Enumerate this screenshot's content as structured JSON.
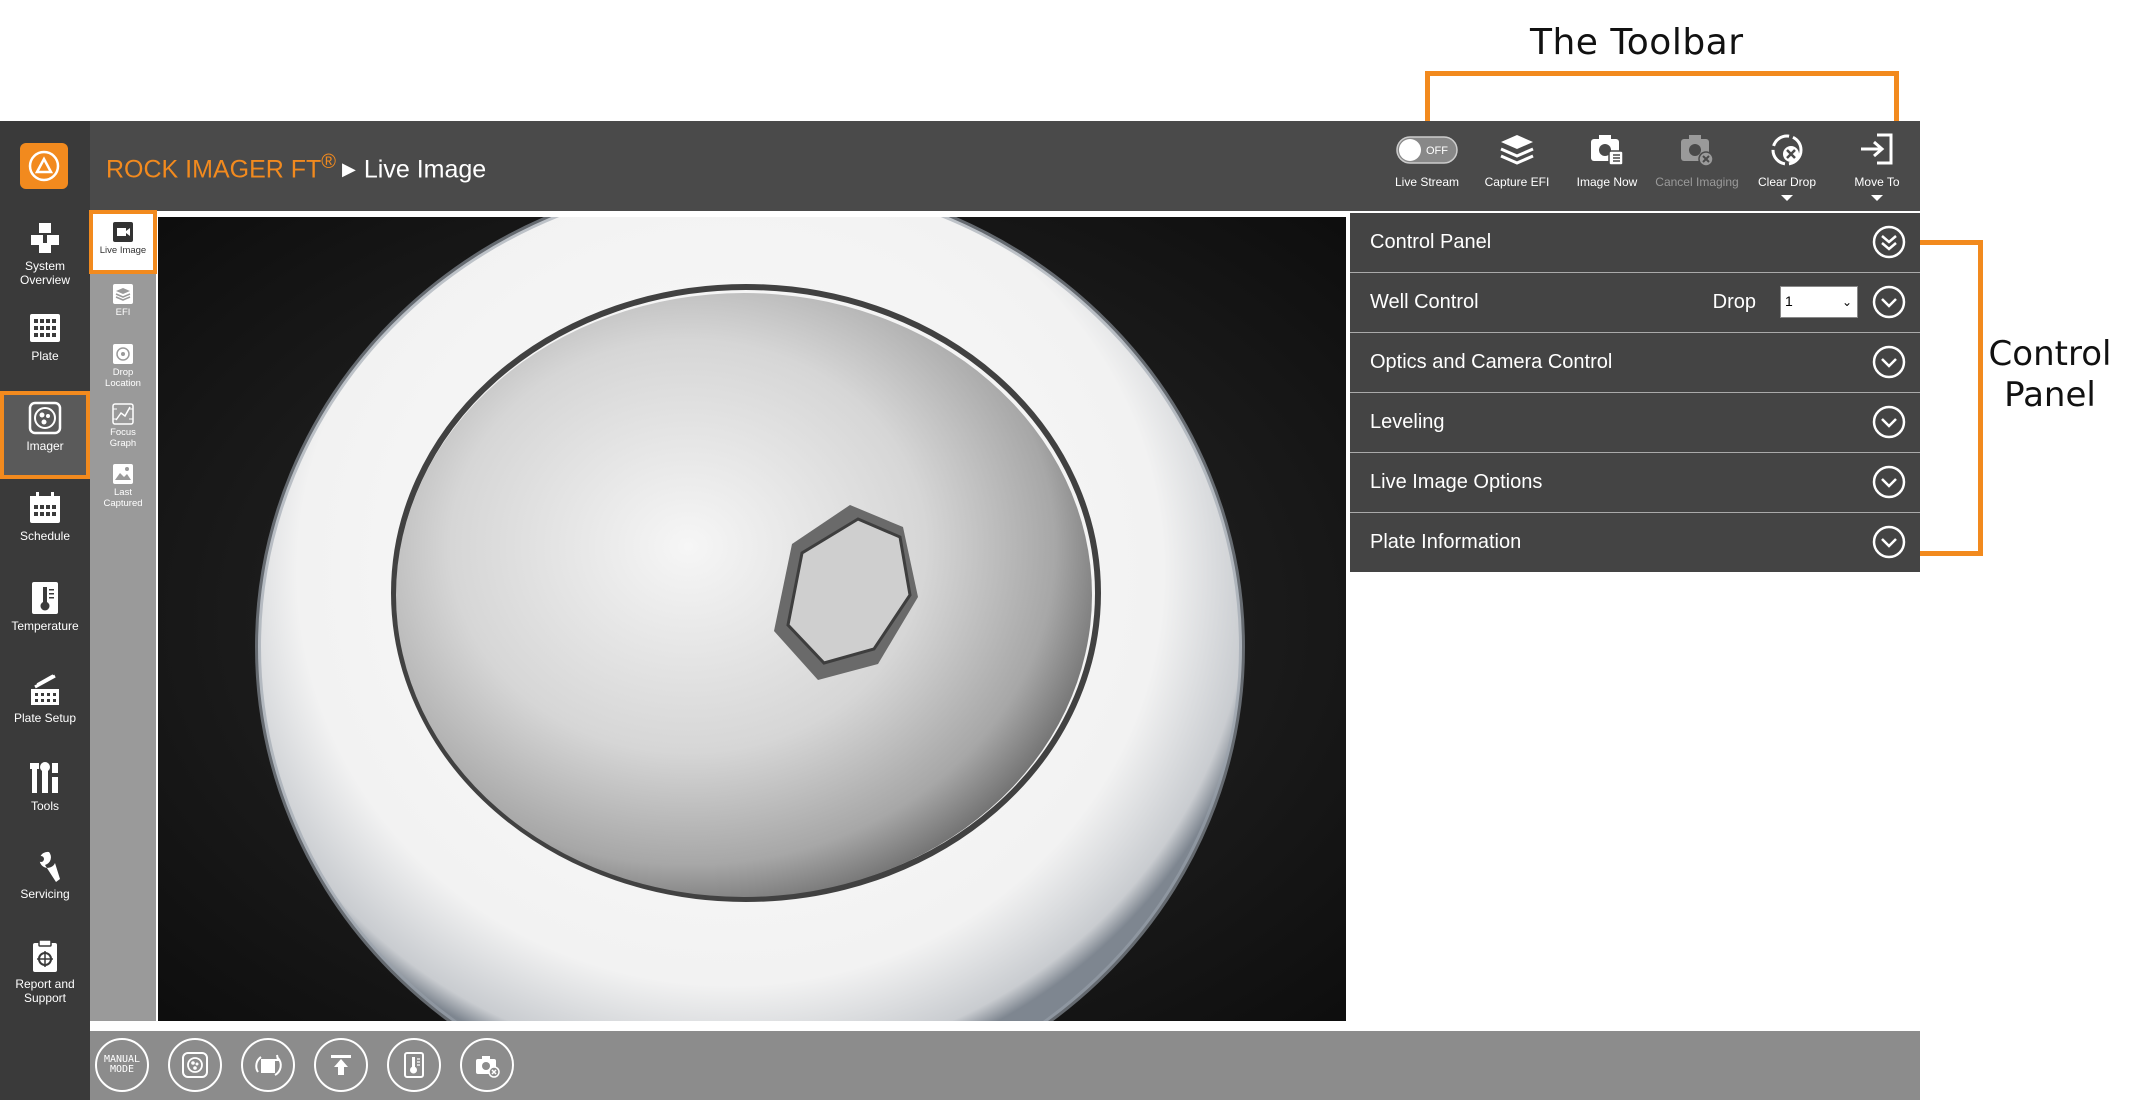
{
  "annotations": {
    "toolbar_title": "The Toolbar",
    "control_panel_title_line1": "Control",
    "control_panel_title_line2": "Panel",
    "accent_color": "#f28a1e"
  },
  "header": {
    "app_name": "ROCK IMAGER FT",
    "registered_mark": "®",
    "page_title": "Live Image"
  },
  "sidebar": {
    "items": [
      {
        "label_line1": "System",
        "label_line2": "Overview",
        "icon": "cubes-icon"
      },
      {
        "label_line1": "Plate",
        "label_line2": "",
        "icon": "plate-grid-icon"
      },
      {
        "label_line1": "Imager",
        "label_line2": "",
        "icon": "imager-icon",
        "active": true
      },
      {
        "label_line1": "Schedule",
        "label_line2": "",
        "icon": "calendar-icon"
      },
      {
        "label_line1": "Temperature",
        "label_line2": "",
        "icon": "thermometer-icon"
      },
      {
        "label_line1": "Plate Setup",
        "label_line2": "",
        "icon": "plate-setup-icon"
      },
      {
        "label_line1": "Tools",
        "label_line2": "",
        "icon": "tools-icon"
      },
      {
        "label_line1": "Servicing",
        "label_line2": "",
        "icon": "wrench-icon"
      },
      {
        "label_line1": "Report and",
        "label_line2": "Support",
        "icon": "clipboard-icon"
      }
    ]
  },
  "toolbar": {
    "live_stream": {
      "label": "Live Stream",
      "toggle_text": "OFF",
      "state": "off"
    },
    "capture_efi": {
      "label": "Capture EFI"
    },
    "image_now": {
      "label": "Image Now"
    },
    "cancel_imaging": {
      "label": "Cancel Imaging",
      "disabled": true
    },
    "clear_drop": {
      "label": "Clear Drop"
    },
    "move_to": {
      "label": "Move To"
    }
  },
  "subnav": {
    "items": [
      {
        "label_line1": "Live Image",
        "label_line2": "",
        "active": true
      },
      {
        "label_line1": "EFI",
        "label_line2": ""
      },
      {
        "label_line1": "Drop",
        "label_line2": "Location"
      },
      {
        "label_line1": "Focus",
        "label_line2": "Graph"
      },
      {
        "label_line1": "Last",
        "label_line2": "Captured"
      }
    ]
  },
  "control_panel": {
    "header": "Control Panel",
    "sections": [
      {
        "label": "Well Control"
      },
      {
        "label": "Optics and Camera Control"
      },
      {
        "label": "Leveling"
      },
      {
        "label": "Live Image Options"
      },
      {
        "label": "Plate Information"
      }
    ],
    "drop_label": "Drop",
    "drop_value": "1"
  },
  "bottom_bar": {
    "manual_mode_line1": "MANUAL",
    "manual_mode_line2": "MODE"
  }
}
